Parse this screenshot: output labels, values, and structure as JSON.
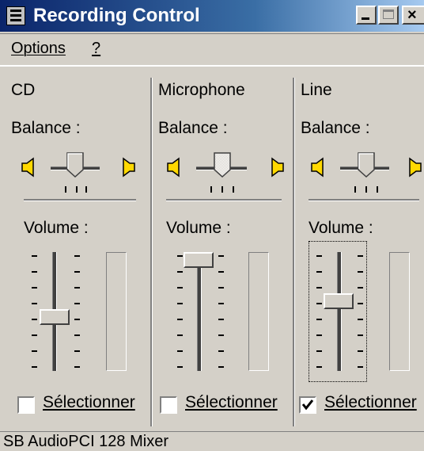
{
  "window": {
    "title": "Recording Control",
    "controls": [
      "minimize",
      "maximize",
      "close"
    ]
  },
  "menu": {
    "options_label": "Options",
    "help_label": "?"
  },
  "channels": [
    {
      "name": "CD",
      "balance_label": "Balance :",
      "balance_position": "center",
      "volume_label": "Volume :",
      "volume_level": 0.45,
      "select_label": "Sélectionner",
      "selected": false
    },
    {
      "name": "Microphone",
      "balance_label": "Balance :",
      "balance_position": "center",
      "volume_label": "Volume :",
      "volume_level": 1.0,
      "select_label": "Sélectionner",
      "selected": false
    },
    {
      "name": "Line",
      "balance_label": "Balance :",
      "balance_position": "center",
      "volume_label": "Volume :",
      "volume_level": 0.6,
      "select_label": "Sélectionner",
      "selected": true
    }
  ],
  "status": {
    "text": "SB AudioPCI 128 Mixer"
  },
  "colors": {
    "face": "#d4d0c8",
    "title_start": "#0a246a",
    "title_end": "#a6caf0"
  }
}
